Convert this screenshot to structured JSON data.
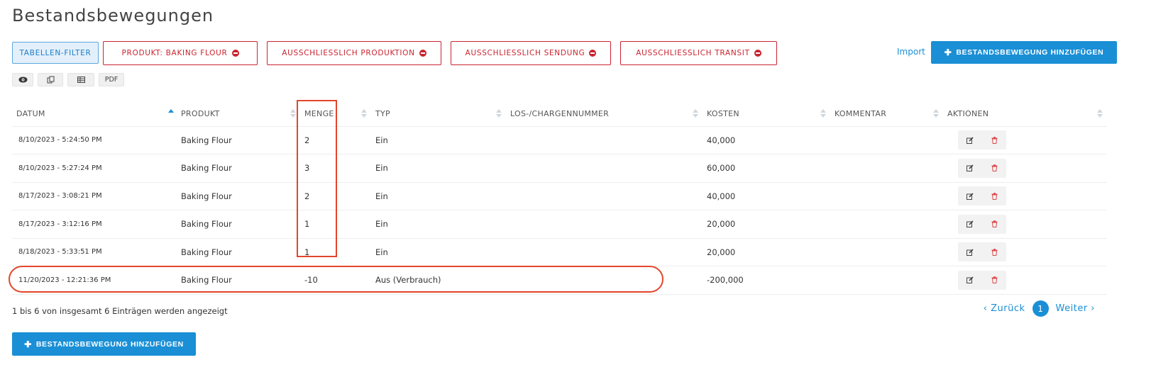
{
  "page": {
    "title": "Bestandsbewegungen"
  },
  "filters": {
    "toggle_label": "TABELLEN-FILTER",
    "chips": [
      {
        "label": "PRODUKT: BAKING FLOUR"
      },
      {
        "label": "AUSSCHLIESSLICH PRODUKTION"
      },
      {
        "label": "AUSSCHLIESSLICH SENDUNG"
      },
      {
        "label": "AUSSCHLIESSLICH TRANSIT"
      }
    ],
    "import_label": "Import",
    "add_label": "BESTANDSBEWEGUNG HINZUFÜGEN"
  },
  "export": {
    "pdf_label": "PDF"
  },
  "table": {
    "columns": [
      "DATUM",
      "PRODUKT",
      "MENGE",
      "TYP",
      "LOS-/CHARGENNUMMER",
      "KOSTEN",
      "KOMMENTAR",
      "AKTIONEN"
    ],
    "rows": [
      {
        "datum": "8/10/2023 - 5:24:50 PM",
        "produkt": "Baking Flour",
        "menge": "2",
        "typ": "Ein",
        "los": "",
        "kosten": "40,000",
        "kommentar": ""
      },
      {
        "datum": "8/10/2023 - 5:27:24 PM",
        "produkt": "Baking Flour",
        "menge": "3",
        "typ": "Ein",
        "los": "",
        "kosten": "60,000",
        "kommentar": ""
      },
      {
        "datum": "8/17/2023 - 3:08:21 PM",
        "produkt": "Baking Flour",
        "menge": "2",
        "typ": "Ein",
        "los": "",
        "kosten": "40,000",
        "kommentar": ""
      },
      {
        "datum": "8/17/2023 - 3:12:16 PM",
        "produkt": "Baking Flour",
        "menge": "1",
        "typ": "Ein",
        "los": "",
        "kosten": "20,000",
        "kommentar": ""
      },
      {
        "datum": "8/18/2023 - 5:33:51 PM",
        "produkt": "Baking Flour",
        "menge": "1",
        "typ": "Ein",
        "los": "",
        "kosten": "20,000",
        "kommentar": ""
      },
      {
        "datum": "11/20/2023 - 12:21:36 PM",
        "produkt": "Baking Flour",
        "menge": "-10",
        "typ": "Aus (Verbrauch)",
        "los": "",
        "kosten": "-200,000",
        "kommentar": ""
      }
    ]
  },
  "footer": {
    "info": "1 bis 6 von insgesamt 6 Einträgen werden angezeigt",
    "prev_label": "‹ Zurück",
    "current_page": "1",
    "next_label": "Weiter ›",
    "add_label": "BESTANDSBEWEGUNG HINZUFÜGEN"
  },
  "colors": {
    "primary": "#1a8fd6",
    "danger": "#c9242f",
    "highlight": "#e2462b"
  },
  "icons": [
    "eye-icon",
    "copy-icon",
    "csv-icon",
    "sort-icon",
    "edit-icon",
    "delete-icon",
    "remove-filter-icon",
    "plus-icon"
  ]
}
